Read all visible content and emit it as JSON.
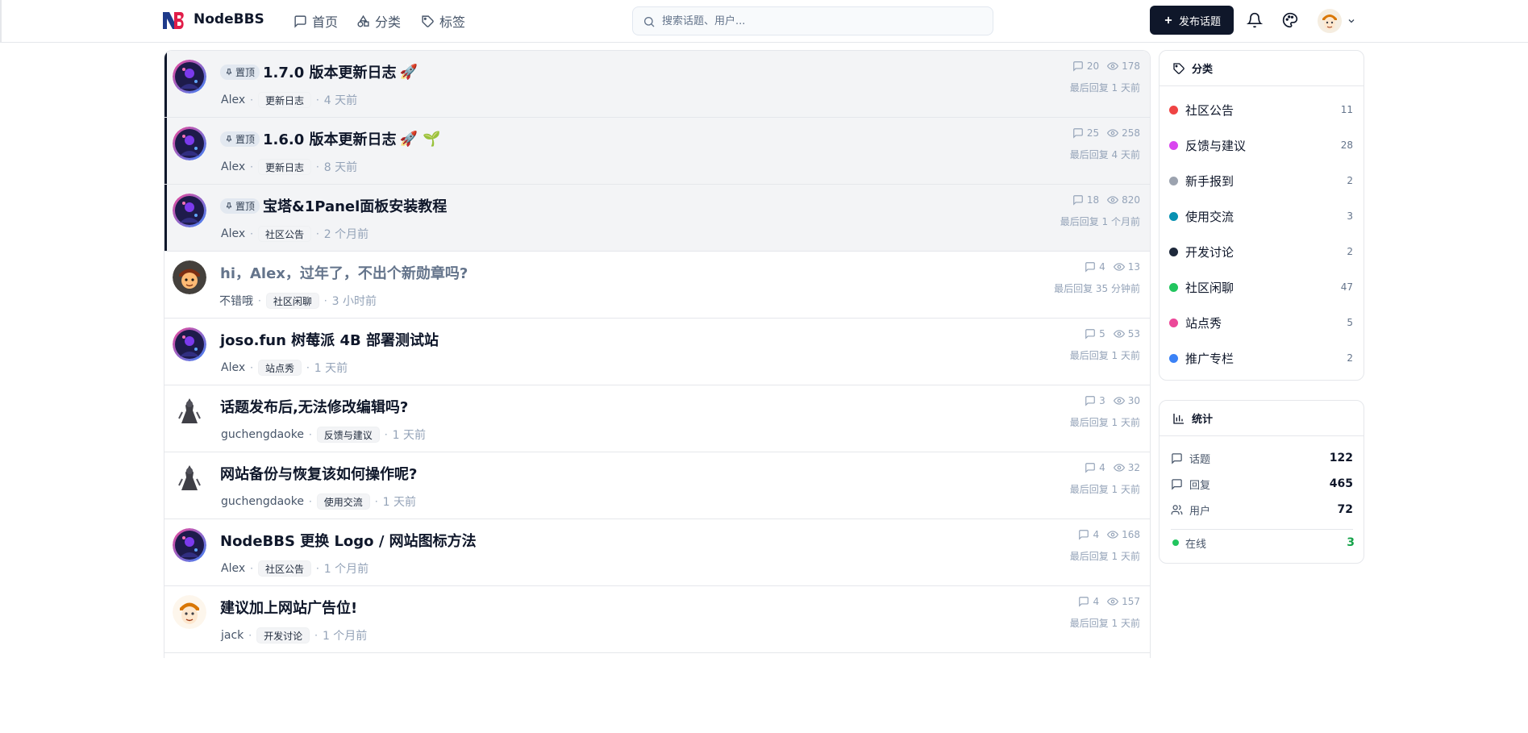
{
  "header": {
    "brand": "NodeBBS",
    "nav": [
      {
        "label": "首页",
        "icon": "message-square-icon"
      },
      {
        "label": "分类",
        "icon": "shapes-icon"
      },
      {
        "label": "标签",
        "icon": "tag-icon"
      }
    ],
    "search_placeholder": "搜索话题、用户...",
    "publish_label": "发布话题",
    "accent": "#0f172a"
  },
  "pin_label": "置顶",
  "topics": [
    {
      "title": "1.7.0 版本更新日志",
      "emoji": "🚀",
      "pinned": true,
      "author": "Alex",
      "category": "更新日志",
      "time": "4 天前",
      "replies": "20",
      "views": "178",
      "last_reply": "最后回复 1 天前"
    },
    {
      "title": "1.6.0 版本更新日志",
      "emoji": "🚀 🌱",
      "pinned": true,
      "author": "Alex",
      "category": "更新日志",
      "time": "8 天前",
      "replies": "25",
      "views": "258",
      "last_reply": "最后回复 4 天前"
    },
    {
      "title": "宝塔&1Panel面板安装教程",
      "emoji": "",
      "pinned": true,
      "author": "Alex",
      "category": "社区公告",
      "time": "2 个月前",
      "replies": "18",
      "views": "820",
      "last_reply": "最后回复 1 个月前"
    },
    {
      "title": "hi，Alex，过年了，不出个新勋章吗?",
      "emoji": "",
      "pinned": false,
      "read": true,
      "author": "不错哦",
      "category": "社区闲聊",
      "time": "3 小时前",
      "replies": "4",
      "views": "13",
      "last_reply": "最后回复 35 分钟前"
    },
    {
      "title": "joso.fun 树莓派 4B 部署测试站",
      "emoji": "",
      "pinned": false,
      "author": "Alex",
      "category": "站点秀",
      "time": "1 天前",
      "replies": "5",
      "views": "53",
      "last_reply": "最后回复 1 天前"
    },
    {
      "title": "话题发布后,无法修改编辑吗?",
      "emoji": "",
      "pinned": false,
      "author": "guchengdaoke",
      "category": "反馈与建议",
      "time": "1 天前",
      "replies": "3",
      "views": "30",
      "last_reply": "最后回复 1 天前"
    },
    {
      "title": "网站备份与恢复该如何操作呢?",
      "emoji": "",
      "pinned": false,
      "author": "guchengdaoke",
      "category": "使用交流",
      "time": "1 天前",
      "replies": "4",
      "views": "32",
      "last_reply": "最后回复 1 天前"
    },
    {
      "title": "NodeBBS 更换 Logo / 网站图标方法",
      "emoji": "",
      "pinned": false,
      "author": "Alex",
      "category": "社区公告",
      "time": "1 个月前",
      "replies": "4",
      "views": "168",
      "last_reply": "最后回复 1 天前"
    },
    {
      "title": "建议加上网站广告位!",
      "emoji": "",
      "pinned": false,
      "author": "jack",
      "category": "开发讨论",
      "time": "1 个月前",
      "replies": "4",
      "views": "157",
      "last_reply": "最后回复 1 天前"
    }
  ],
  "sidebar": {
    "categories_title": "分类",
    "categories": [
      {
        "name": "社区公告",
        "count": "11",
        "color": "#ef4444"
      },
      {
        "name": "反馈与建议",
        "count": "28",
        "color": "#d946ef"
      },
      {
        "name": "新手报到",
        "count": "2",
        "color": "#9ca3af"
      },
      {
        "name": "使用交流",
        "count": "3",
        "color": "#0891b2"
      },
      {
        "name": "开发讨论",
        "count": "2",
        "color": "#1e293b"
      },
      {
        "name": "社区闲聊",
        "count": "47",
        "color": "#22c55e"
      },
      {
        "name": "站点秀",
        "count": "5",
        "color": "#ec4899"
      },
      {
        "name": "推广专栏",
        "count": "2",
        "color": "#3b82f6"
      }
    ],
    "stats_title": "统计",
    "stats": [
      {
        "label": "话题",
        "value": "122"
      },
      {
        "label": "回复",
        "value": "465"
      },
      {
        "label": "用户",
        "value": "72"
      }
    ],
    "online_label": "在线",
    "online_value": "3"
  }
}
